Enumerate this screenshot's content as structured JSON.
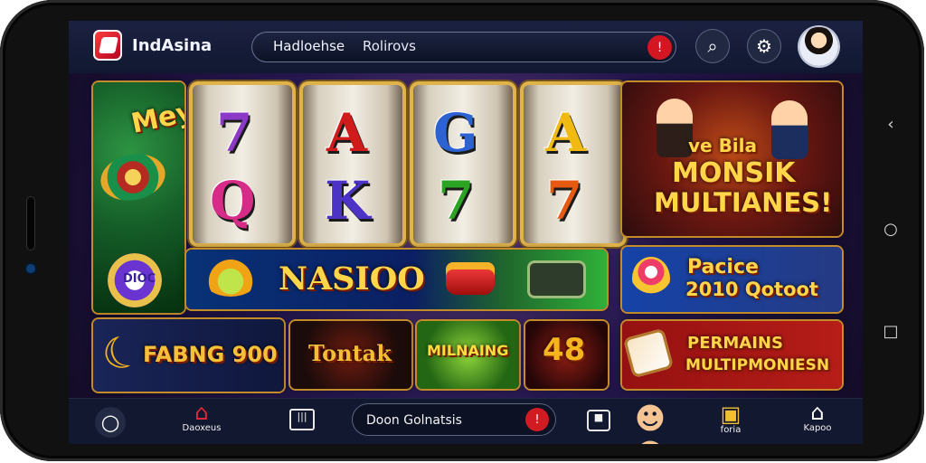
{
  "app": {
    "name": "IndAsina"
  },
  "search": {
    "text_left": "Hadloehse",
    "text_right": "Rolirovs"
  },
  "header_icons": {
    "notification": "alert-icon",
    "search": "search-icon",
    "settings": "gear-icon",
    "profile": "avatar"
  },
  "reels": [
    [
      "7",
      "Q"
    ],
    [
      "A",
      "K"
    ],
    [
      "G",
      "7"
    ],
    [
      "A",
      "7"
    ]
  ],
  "tiles": {
    "left_top": "Mey",
    "left_mid": "DIOC",
    "bonus_banner": "NASIOO",
    "left_bottom": "FABNG 900",
    "small_1": "Tontak",
    "small_2": "MILNAING",
    "small_3": "48",
    "right_top_1": "ve Bila",
    "right_top_2": "MONSIK",
    "right_top_3": "MULTIANES!",
    "right_mid_1": "Pacice",
    "right_mid_2": "2010 Qotoot",
    "right_bottom_1": "PERMAINS",
    "right_bottom_2": "MULTIPMONIESN"
  },
  "bottom": {
    "home_label": "Daoxeus",
    "search_text": "Doon Golnatsis",
    "gift_label": "foria",
    "house_label": "Kapoo"
  }
}
